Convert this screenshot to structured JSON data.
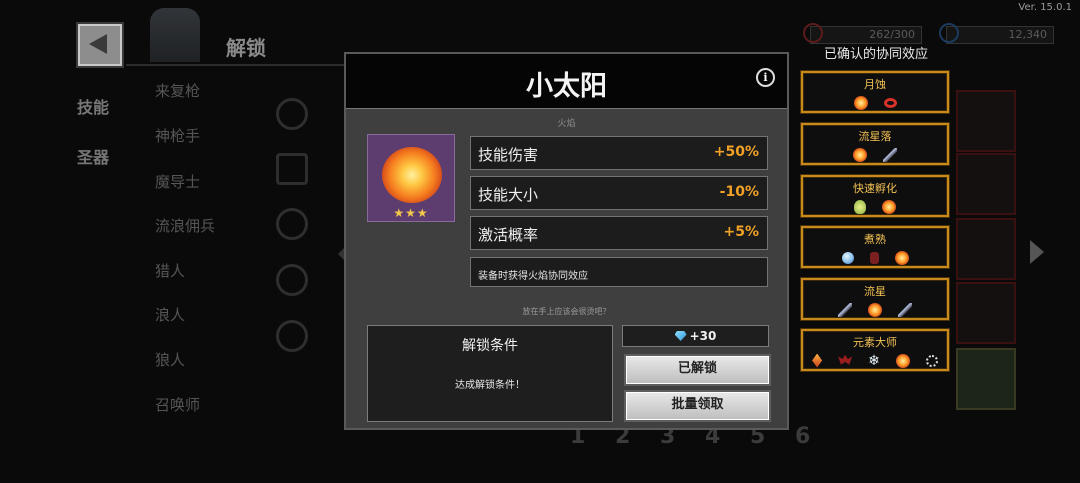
{
  "version": "Ver. 15.0.1",
  "header": {
    "title": "解锁",
    "energy": "262/300",
    "gems": "12,340"
  },
  "nav": {
    "skills": "技能",
    "artifacts": "圣器"
  },
  "class_list": [
    "来复枪",
    "神枪手",
    "魔导士",
    "流浪佣兵",
    "猎人",
    "浪人",
    "狼人",
    "召唤师"
  ],
  "pages": [
    "1",
    "2",
    "3",
    "4",
    "5",
    "6"
  ],
  "modal": {
    "skill_name": "小太阳",
    "element": "火焰",
    "stars": "★★★",
    "stats": [
      {
        "name": "技能伤害",
        "value": "+50%"
      },
      {
        "name": "技能大小",
        "value": "-10%"
      },
      {
        "name": "激活概率",
        "value": "+5%"
      }
    ],
    "effect": "装备时获得火焰协同效应",
    "hint": "放在手上应该会很烫吧？",
    "condition_title": "解锁条件",
    "condition_text": "达成解锁条件！",
    "reward": "+30",
    "unlocked_label": "已解锁",
    "batch_claim_label": "批量领取"
  },
  "synergy": {
    "title": "已确认的协同效应",
    "items": [
      {
        "name": "月蚀",
        "icons": [
          "fire",
          "ring"
        ]
      },
      {
        "name": "流星落",
        "icons": [
          "fire",
          "dart"
        ]
      },
      {
        "name": "快速孵化",
        "icons": [
          "egg",
          "fire"
        ]
      },
      {
        "name": "煮熟",
        "icons": [
          "orb",
          "pot",
          "fire"
        ]
      },
      {
        "name": "流星",
        "icons": [
          "dart",
          "fire",
          "dart"
        ]
      },
      {
        "name": "元素大师",
        "icons": [
          "crystal",
          "bat",
          "snow",
          "fire",
          "swirl"
        ]
      }
    ]
  },
  "colors": {
    "accent": "#f0a126",
    "synergy_border": "#c88a1c",
    "skill_frame": "#5d3d6f"
  }
}
